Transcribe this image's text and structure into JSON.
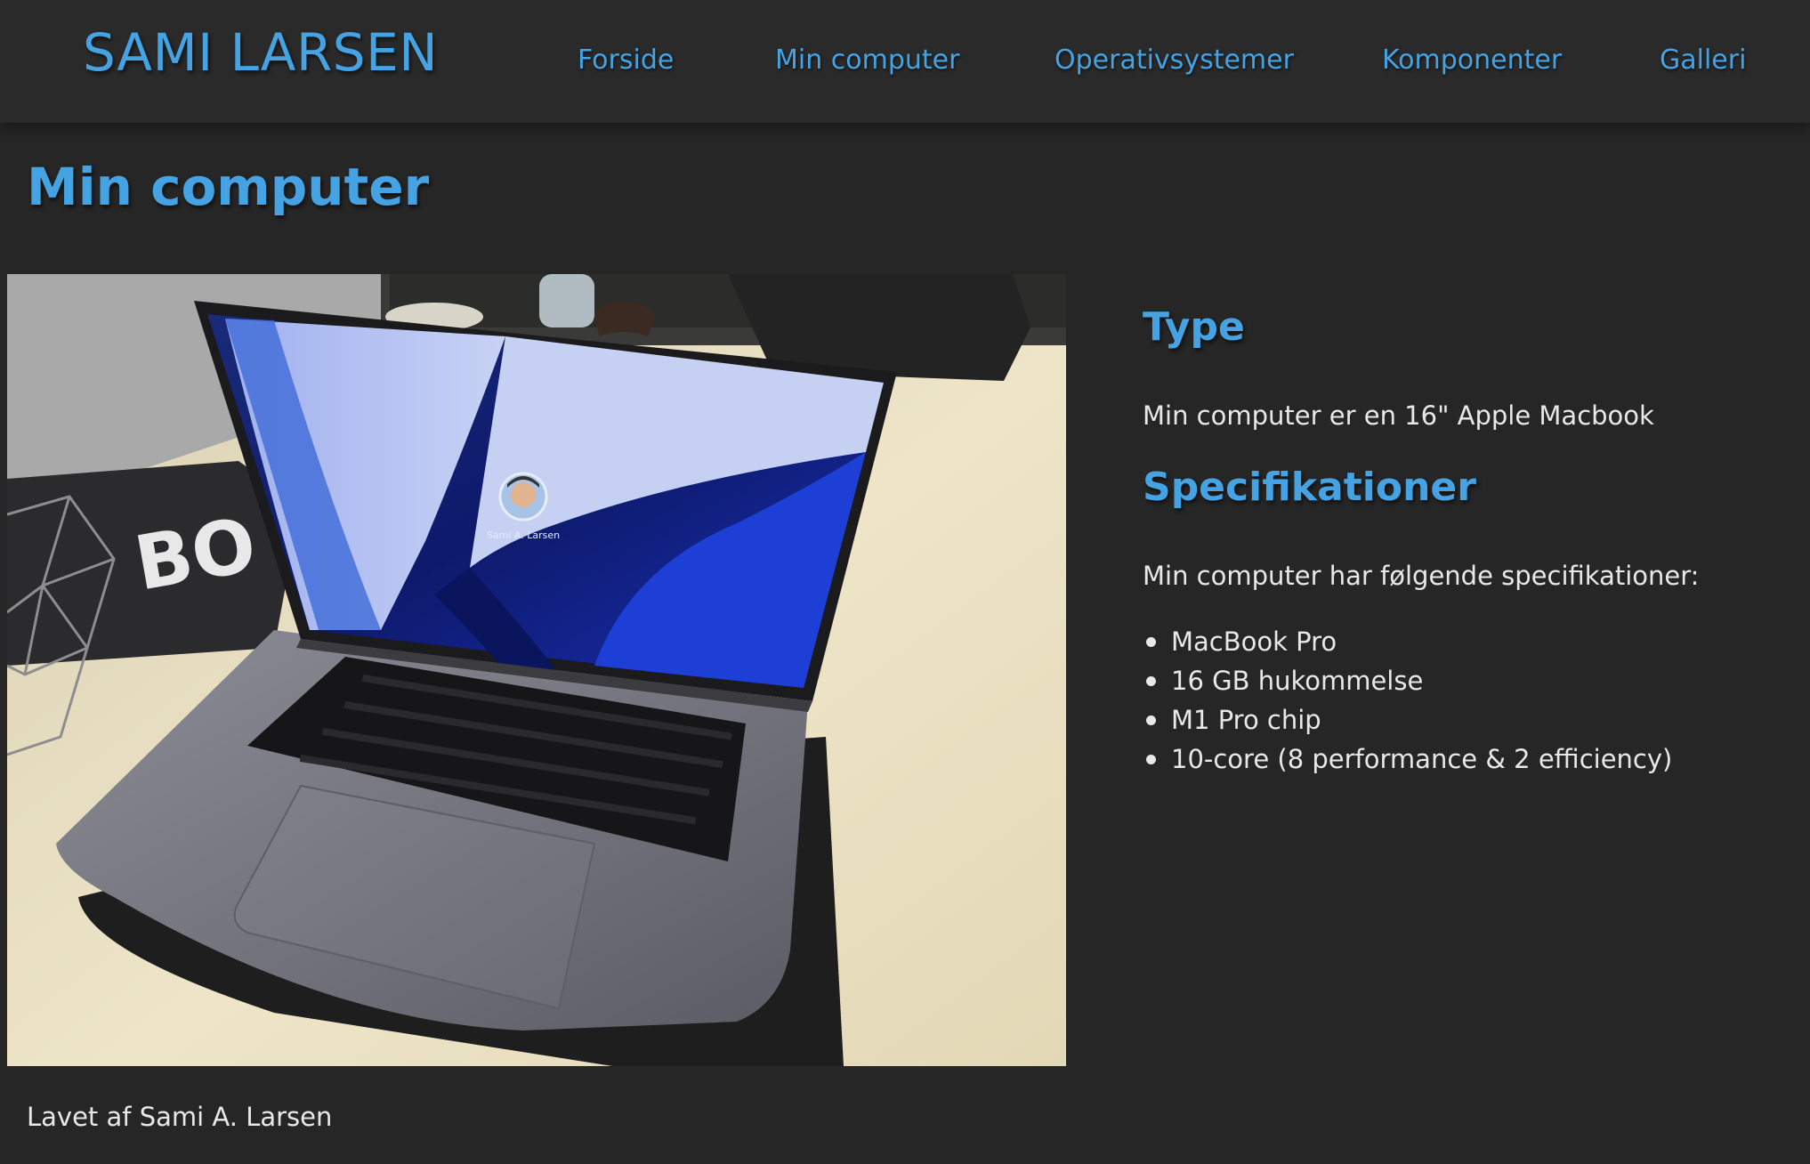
{
  "header": {
    "logo": "SAMI LARSEN",
    "nav": [
      {
        "label": "Forside"
      },
      {
        "label": "Min computer"
      },
      {
        "label": "Operativsystemer"
      },
      {
        "label": "Komponenter"
      },
      {
        "label": "Galleri"
      }
    ]
  },
  "main": {
    "title": "Min computer",
    "type_heading": "Type",
    "type_text": "Min computer er en 16\" Apple Macbook",
    "spec_heading": "Specifikationer",
    "spec_intro": "Min computer har følgende specifikationer:",
    "specs": [
      "MacBook Pro",
      "16 GB hukommelse",
      "M1 Pro chip",
      "10-core (8 performance & 2 efficiency)"
    ]
  },
  "photo": {
    "screen_name": "Sami A. Larsen",
    "bag_text": "BO"
  },
  "footer": {
    "text": "Lavet af Sami A. Larsen"
  },
  "colors": {
    "accent": "#45a3e3",
    "background": "#262626",
    "header_bg": "#2a2a2a",
    "text": "#e8e8e8"
  }
}
